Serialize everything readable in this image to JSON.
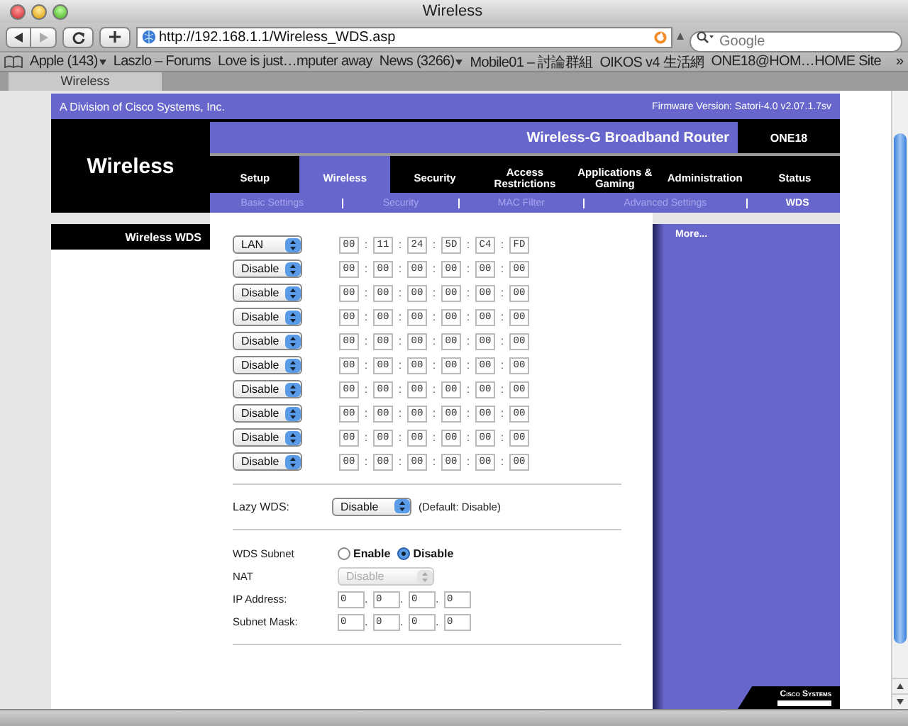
{
  "window": {
    "title": "Wireless"
  },
  "toolbar": {
    "url": "http://192.168.1.1/Wireless_WDS.asp",
    "search": {
      "placeholder": "Google"
    }
  },
  "bookmarks": [
    {
      "label": "Apple (143)",
      "menu": true
    },
    {
      "label": "Laszlo – Forums",
      "menu": false
    },
    {
      "label": "Love is just…mputer away",
      "menu": false
    },
    {
      "label": "News (3266)",
      "menu": true
    },
    {
      "label": "Mobile01 – 討論群組",
      "menu": false
    },
    {
      "label": "OIKOS v4 生活網",
      "menu": false
    },
    {
      "label": "ONE18@HOM…HOME Site",
      "menu": false
    }
  ],
  "bookmarks_overflow": "»",
  "tabs": [
    {
      "label": "Wireless",
      "selected": true
    }
  ],
  "router": {
    "division": "A Division of Cisco Systems, Inc.",
    "firmware": "Firmware Version: Satori-4.0 v2.07.1.7sv",
    "section": "Wireless",
    "product": "Wireless-G Broadband Router",
    "model": "ONE18",
    "tabs": [
      {
        "label": "Setup",
        "selected": false
      },
      {
        "label": "Wireless",
        "selected": true
      },
      {
        "label": "Security",
        "selected": false
      },
      {
        "label": "Access Restrictions",
        "selected": false
      },
      {
        "label": "Applications & Gaming",
        "selected": false
      },
      {
        "label": "Administration",
        "selected": false
      },
      {
        "label": "Status",
        "selected": false
      }
    ],
    "subtabs": [
      {
        "label": "Basic Settings",
        "selected": false
      },
      {
        "label": "Security",
        "selected": false
      },
      {
        "label": "MAC Filter",
        "selected": false
      },
      {
        "label": "Advanced Settings",
        "selected": false
      },
      {
        "label": "WDS",
        "selected": true
      }
    ],
    "side_title": "Wireless WDS",
    "more": "More...",
    "logo": "Cisco Systems"
  },
  "wds": {
    "separator": ":",
    "rows": [
      {
        "mode": "LAN",
        "mac": [
          "00",
          "11",
          "24",
          "5D",
          "C4",
          "FD"
        ]
      },
      {
        "mode": "Disable",
        "mac": [
          "00",
          "00",
          "00",
          "00",
          "00",
          "00"
        ]
      },
      {
        "mode": "Disable",
        "mac": [
          "00",
          "00",
          "00",
          "00",
          "00",
          "00"
        ]
      },
      {
        "mode": "Disable",
        "mac": [
          "00",
          "00",
          "00",
          "00",
          "00",
          "00"
        ]
      },
      {
        "mode": "Disable",
        "mac": [
          "00",
          "00",
          "00",
          "00",
          "00",
          "00"
        ]
      },
      {
        "mode": "Disable",
        "mac": [
          "00",
          "00",
          "00",
          "00",
          "00",
          "00"
        ]
      },
      {
        "mode": "Disable",
        "mac": [
          "00",
          "00",
          "00",
          "00",
          "00",
          "00"
        ]
      },
      {
        "mode": "Disable",
        "mac": [
          "00",
          "00",
          "00",
          "00",
          "00",
          "00"
        ]
      },
      {
        "mode": "Disable",
        "mac": [
          "00",
          "00",
          "00",
          "00",
          "00",
          "00"
        ]
      },
      {
        "mode": "Disable",
        "mac": [
          "00",
          "00",
          "00",
          "00",
          "00",
          "00"
        ]
      }
    ]
  },
  "lazy_wds": {
    "label": "Lazy WDS:",
    "value": "Disable",
    "hint": "(Default: Disable)"
  },
  "wds_subnet": {
    "label": "WDS Subnet",
    "options": [
      {
        "label": "Enable",
        "selected": false
      },
      {
        "label": "Disable",
        "selected": true
      }
    ]
  },
  "nat": {
    "label": "NAT",
    "value": "Disable",
    "disabled": true
  },
  "addresses": {
    "separator": ".",
    "fields": [
      {
        "label": "IP Address:",
        "octets": [
          "0",
          "0",
          "0",
          "0"
        ]
      },
      {
        "label": "Subnet Mask:",
        "octets": [
          "0",
          "0",
          "0",
          "0"
        ]
      }
    ]
  }
}
